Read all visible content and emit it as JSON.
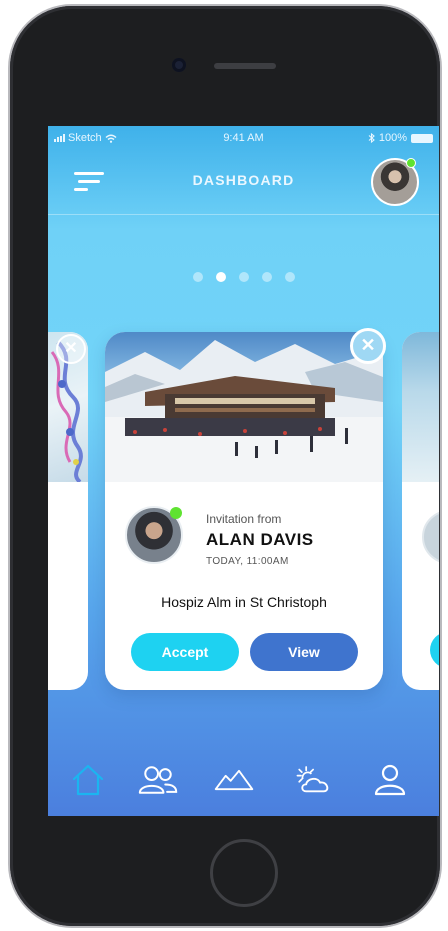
{
  "status_bar": {
    "carrier": "Sketch",
    "time": "9:41 AM",
    "battery": "100%"
  },
  "header": {
    "title": "DASHBOARD"
  },
  "pager": {
    "count": 5,
    "active_index": 1
  },
  "card": {
    "invitation_label": "Invitation from",
    "sender_name": "ALAN DAVIS",
    "datetime": "TODAY, 11:00AM",
    "place": "Hospiz Alm in St Christoph",
    "accept_label": "Accept",
    "view_label": "View"
  },
  "tab_bar": {
    "items": [
      {
        "icon": "home-icon",
        "active": true
      },
      {
        "icon": "friends-icon",
        "active": false
      },
      {
        "icon": "mountains-icon",
        "active": false
      },
      {
        "icon": "weather-icon",
        "active": false
      },
      {
        "icon": "profile-icon",
        "active": false
      }
    ]
  },
  "colors": {
    "accent_cyan": "#1ED2F1",
    "view_blue": "#3F74CE",
    "online_green": "#5FE331",
    "active_tab": "#1BB5F0"
  }
}
